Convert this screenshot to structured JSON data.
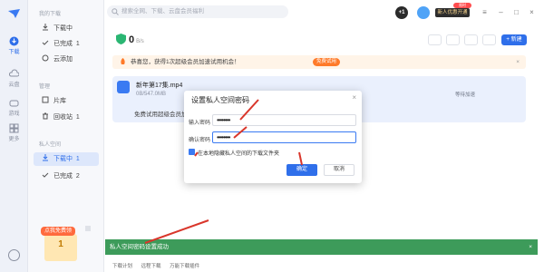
{
  "rail": {
    "items": [
      {
        "label": "下载",
        "icon": "download-icon"
      },
      {
        "label": "云盘",
        "icon": "cloud-icon"
      },
      {
        "label": "游戏",
        "icon": "gamepad-icon"
      },
      {
        "label": "更多",
        "icon": "grid-icon"
      }
    ]
  },
  "sidebar": {
    "section_mine": "我的下载",
    "section_trash": "管理",
    "section_private": "私人空间",
    "mine_items": [
      {
        "label": "下载中",
        "count": ""
      },
      {
        "label": "已完成",
        "count": "1"
      },
      {
        "label": "云添加",
        "count": ""
      }
    ],
    "trash_items": [
      {
        "label": "片库",
        "count": ""
      },
      {
        "label": "回收站",
        "count": "1"
      }
    ],
    "private_items": [
      {
        "label": "下载中",
        "count": "1"
      },
      {
        "label": "已完成",
        "count": "2"
      }
    ],
    "promo_tag": "点我免费领",
    "promo_badge": "1"
  },
  "header": {
    "search_placeholder": "搜索全网、下载、云盘会员福利",
    "points": "+1",
    "vip_label": "新人优惠开通",
    "vip_badge": "限时"
  },
  "toolbar": {
    "speed_value": "0",
    "speed_unit": "B/s",
    "new_label": "+ 新建"
  },
  "banner": {
    "text": "恭喜您，获得1次超级会员加速试用机会！",
    "button": "免费试用"
  },
  "task": {
    "name": "新年第17集.mp4",
    "size": "0B/547.0MB",
    "status": "等待加速",
    "trial_text": "免费试用超级会员加速"
  },
  "dialog": {
    "title": "设置私人空间密码",
    "password_label": "输入密码",
    "password_value": "••••••••",
    "confirm_label": "确认密码",
    "confirm_value": "••••••••",
    "checkbox_label": "在本地隐藏私人空间的下载文件夹",
    "ok_label": "确定",
    "cancel_label": "取消"
  },
  "toast": {
    "text": "私人空间密码设置成功"
  },
  "footer": {
    "items": [
      "下载计划",
      "远程下载",
      "万能下载插件"
    ]
  },
  "colors": {
    "accent": "#2f6fea",
    "toast": "#3d9b5a",
    "arrow": "#d9362b"
  }
}
